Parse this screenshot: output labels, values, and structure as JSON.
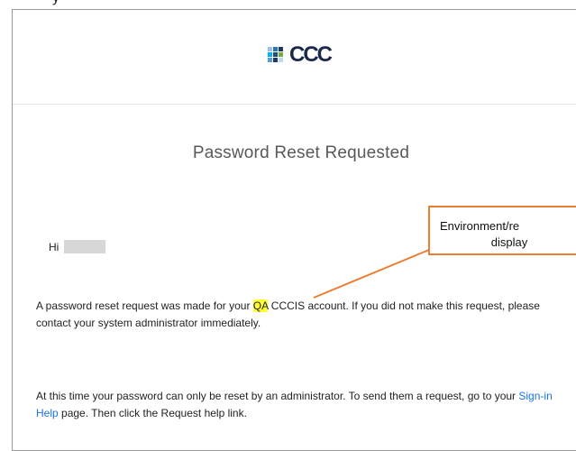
{
  "fragment_text": "y",
  "email": {
    "logo_text": "CCC",
    "title": "Password Reset Requested",
    "greeting": "Hi",
    "paragraph1": {
      "before": "A password reset request was made for your ",
      "highlight": "QA",
      "after": " CCCIS account. If you did not make this request, please contact your system administrator immediately."
    },
    "paragraph2": {
      "before": "At this time your password can only be reset by an administrator. To send them a request, go to your ",
      "link": "Sign-in Help",
      "after": " page. Then click the Request help link."
    }
  },
  "callout": {
    "line1": "Environment/re",
    "line2": "display",
    "color": "#ed7d31"
  },
  "colors": {
    "highlight": "#ffff33",
    "link": "#1a73e8",
    "title": "#595959"
  }
}
